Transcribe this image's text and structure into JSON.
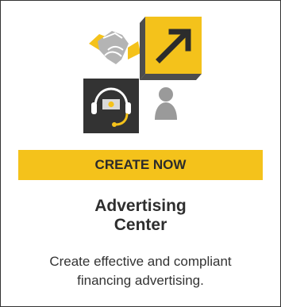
{
  "card": {
    "cta_label": "CREATE NOW",
    "title_line1": "Advertising",
    "title_line2": "Center",
    "description_line1": "Create effective and compliant",
    "description_line2": "financing advertising."
  },
  "icons": {
    "handshake": "handshake-icon",
    "arrow": "arrow-up-right-icon",
    "headset": "headset-icon",
    "person": "person-icon"
  },
  "colors": {
    "accent": "#f4c21b",
    "dark_tile": "#333333",
    "text": "#333333",
    "person_gray": "#9a9a9a"
  }
}
